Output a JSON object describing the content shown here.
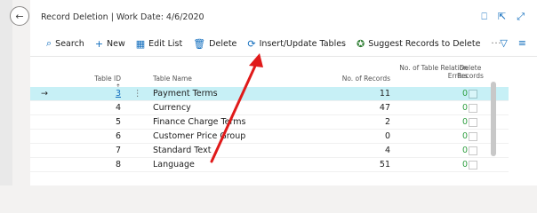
{
  "title": "Record Deletion | Work Date: 4/6/2020",
  "actions": {
    "search": "Search",
    "new": "New",
    "edit_list": "Edit List",
    "delete": "Delete",
    "insert_update": "Insert/Update Tables",
    "suggest": "Suggest Records to Delete",
    "more": "···"
  },
  "columns": {
    "table_id": "Table ID ↑",
    "table_name": "Table Name",
    "no_records": "No. of Records",
    "no_relation_errors": "No. of Table Relation Errors",
    "delete_records": "Delete Records"
  },
  "rows": [
    {
      "id": "3",
      "name": "Payment Terms",
      "records": "11",
      "errors": "0"
    },
    {
      "id": "4",
      "name": "Currency",
      "records": "47",
      "errors": "0"
    },
    {
      "id": "5",
      "name": "Finance Charge Terms",
      "records": "2",
      "errors": "0"
    },
    {
      "id": "6",
      "name": "Customer Price Group",
      "records": "0",
      "errors": "0"
    },
    {
      "id": "7",
      "name": "Standard Text",
      "records": "4",
      "errors": "0"
    },
    {
      "id": "8",
      "name": "Language",
      "records": "51",
      "errors": "0"
    }
  ],
  "colors": {
    "accent": "#0f6cbd",
    "selected_row": "#c7f0f6",
    "annotation_arrow": "#e01a1a"
  }
}
